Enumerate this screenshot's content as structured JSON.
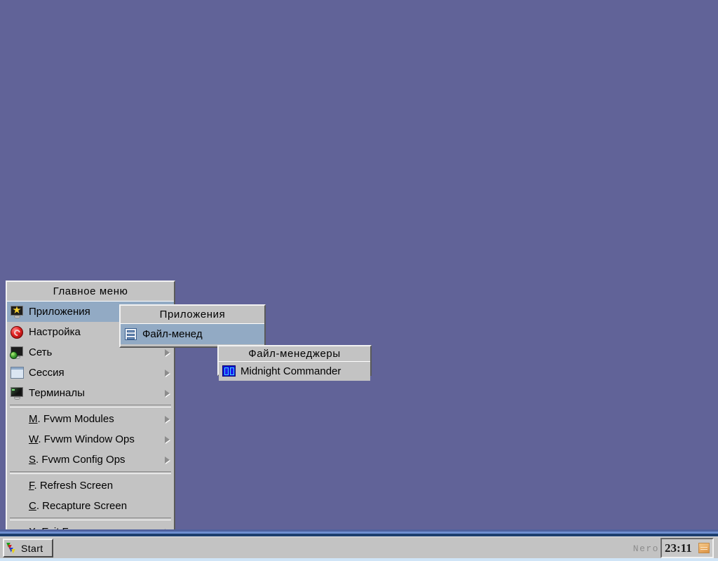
{
  "desktop": {
    "background_color": "#616398"
  },
  "main_menu": {
    "title": "Главное меню",
    "items": [
      {
        "label": "Приложения",
        "icon": "monitor-star-icon",
        "selected": true,
        "arrow": false
      },
      {
        "label": "Настройка",
        "icon": "red-settings-ball-icon",
        "selected": false,
        "arrow": false
      },
      {
        "label": "Сеть",
        "icon": "monitor-globe-icon",
        "selected": false,
        "arrow": true
      },
      {
        "label": "Сессия",
        "icon": "light-window-icon",
        "selected": false,
        "arrow": true
      },
      {
        "label": "Терминалы",
        "icon": "terminal-monitor-icon",
        "selected": false,
        "arrow": true
      },
      {
        "separator": true
      },
      {
        "hotkey": "M",
        "label": ". Fvwm Modules",
        "icon": "none",
        "selected": false,
        "arrow": true
      },
      {
        "hotkey": "W",
        "label": ". Fvwm Window Ops",
        "icon": "none",
        "selected": false,
        "arrow": true
      },
      {
        "hotkey": "S",
        "label": ". Fvwm Config Ops",
        "icon": "none",
        "selected": false,
        "arrow": true
      },
      {
        "separator": true
      },
      {
        "hotkey": "F",
        "label": ". Refresh Screen",
        "icon": "none",
        "selected": false,
        "arrow": false
      },
      {
        "hotkey": "C",
        "label": ". Recapture Screen",
        "icon": "none",
        "selected": false,
        "arrow": false
      },
      {
        "separator": true
      },
      {
        "hotkey": "X",
        "label": ". Exit Fvwm",
        "icon": "none",
        "selected": false,
        "arrow": true
      }
    ]
  },
  "apps_submenu": {
    "title": "Приложения",
    "items": [
      {
        "label": "Файл-менед",
        "icon": "file-manager-icon",
        "selected": true,
        "arrow": false
      }
    ]
  },
  "filemanagers_submenu": {
    "title": "Файл-менеджеры",
    "items": [
      {
        "label": "Midnight Commander",
        "icon": "midnight-commander-icon",
        "selected": false,
        "arrow": false
      }
    ]
  },
  "taskbar": {
    "start_label": "Start",
    "start_icon": "fvwm-logo-icon",
    "tray_text": "Nero",
    "clock": "23:11",
    "clock_icon": "calendar-icon"
  }
}
